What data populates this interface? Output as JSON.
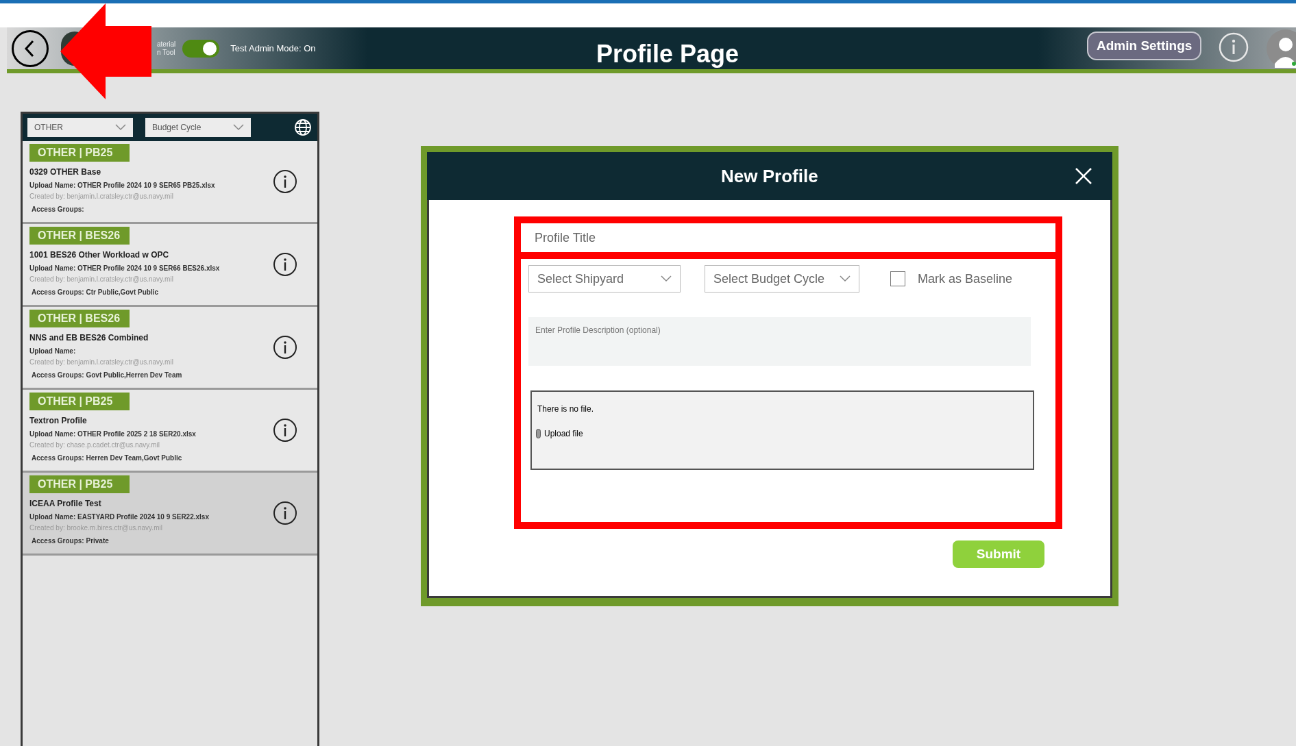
{
  "header": {
    "logo_text": [
      "aterial",
      "n Tool"
    ],
    "admin_mode": {
      "label": "Test Admin Mode: On",
      "on": true
    },
    "title": "Profile Page",
    "admin_button": "Admin Settings"
  },
  "sidebar": {
    "filters": [
      {
        "value": "OTHER"
      },
      {
        "value": "Budget Cycle"
      }
    ],
    "items": [
      {
        "tag": "OTHER | PB25",
        "title": "0329 OTHER Base",
        "upload": "Upload Name: OTHER Profile 2024 10 9 SER65 PB25.xlsx",
        "created": "Created by: benjamin.l.cratsley.ctr@us.navy.mil",
        "access": "Access Groups:",
        "selected": false
      },
      {
        "tag": "OTHER | BES26",
        "title": "1001 BES26 Other Workload w OPC",
        "upload": "Upload Name: OTHER Profile 2024 10 9 SER66 BES26.xlsx",
        "created": "Created by: benjamin.l.cratsley.ctr@us.navy.mil",
        "access": "Access Groups: Ctr Public,Govt Public",
        "selected": false
      },
      {
        "tag": "OTHER | BES26",
        "title": "NNS and EB BES26 Combined",
        "upload": "Upload Name:",
        "created": "Created by: benjamin.l.cratsley.ctr@us.navy.mil",
        "access": "Access Groups: Govt Public,Herren Dev Team",
        "selected": false
      },
      {
        "tag": "OTHER | PB25",
        "title": "Textron Profile",
        "upload": "Upload Name: OTHER Profile 2025 2 18 SER20.xlsx",
        "created": "Created by: chase.p.cadet.ctr@us.navy.mil",
        "access": "Access Groups: Herren Dev Team,Govt Public",
        "selected": false
      },
      {
        "tag": "OTHER | PB25",
        "title": "ICEAA Profile Test",
        "upload": "Upload Name: EASTYARD Profile 2024 10 9 SER22.xlsx",
        "created": "Created by: brooke.m.bires.ctr@us.navy.mil",
        "access": "Access Groups: Private",
        "selected": true
      }
    ]
  },
  "dialog": {
    "title": "New Profile",
    "title_field": {
      "placeholder": "Profile Title"
    },
    "shipyard": {
      "value": "Select Shipyard"
    },
    "budget_cycle": {
      "value": "Select Budget Cycle"
    },
    "baseline": {
      "label": "Mark as Baseline",
      "checked": false
    },
    "description": {
      "placeholder": "Enter Profile Description (optional)"
    },
    "file": {
      "status": "There is no file.",
      "upload": "Upload file"
    },
    "submit": "Submit"
  }
}
